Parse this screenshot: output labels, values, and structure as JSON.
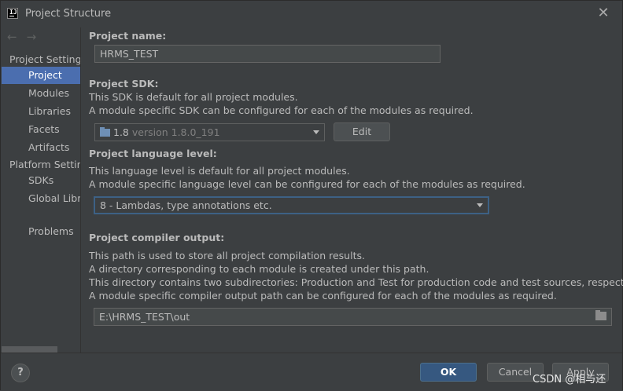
{
  "window": {
    "title": "Project Structure",
    "close_glyph": "✕"
  },
  "nav": {
    "back_glyph": "←",
    "forward_glyph": "→"
  },
  "sidebar": {
    "header_project_settings": "Project Settings",
    "header_platform_settings": "Platform Settings",
    "items": [
      {
        "label": "Project",
        "selected": true
      },
      {
        "label": "Modules"
      },
      {
        "label": "Libraries"
      },
      {
        "label": "Facets"
      },
      {
        "label": "Artifacts"
      },
      {
        "label": "SDKs"
      },
      {
        "label": "Global Libraries"
      },
      {
        "label": "Problems"
      }
    ]
  },
  "project_name": {
    "label": "Project name:",
    "value": "HRMS_TEST"
  },
  "sdk": {
    "label": "Project SDK:",
    "desc1": "This SDK is default for all project modules.",
    "desc2": "A module specific SDK can be configured for each of the modules as required.",
    "selected_name": "1.8",
    "selected_version": "version 1.8.0_191",
    "edit_button": "Edit"
  },
  "language_level": {
    "label": "Project language level:",
    "desc1": "This language level is default for all project modules.",
    "desc2": "A module specific language level can be configured for each of the modules as required.",
    "selected": "8 - Lambdas, type annotations etc."
  },
  "compiler_output": {
    "label": "Project compiler output:",
    "desc1": "This path is used to store all project compilation results.",
    "desc2": "A directory corresponding to each module is created under this path.",
    "desc3": "This directory contains two subdirectories: Production and Test for production code and test sources, respectively.",
    "desc4": "A module specific compiler output path can be configured for each of the modules as required.",
    "path": "E:\\HRMS_TEST\\out"
  },
  "footer": {
    "help_glyph": "?",
    "ok": "OK",
    "cancel": "Cancel",
    "apply": "Apply",
    "watermark": "CSDN @相与还"
  },
  "colors": {
    "accent": "#4b6eaf",
    "primary_button": "#365880",
    "background": "#3c3f41"
  }
}
